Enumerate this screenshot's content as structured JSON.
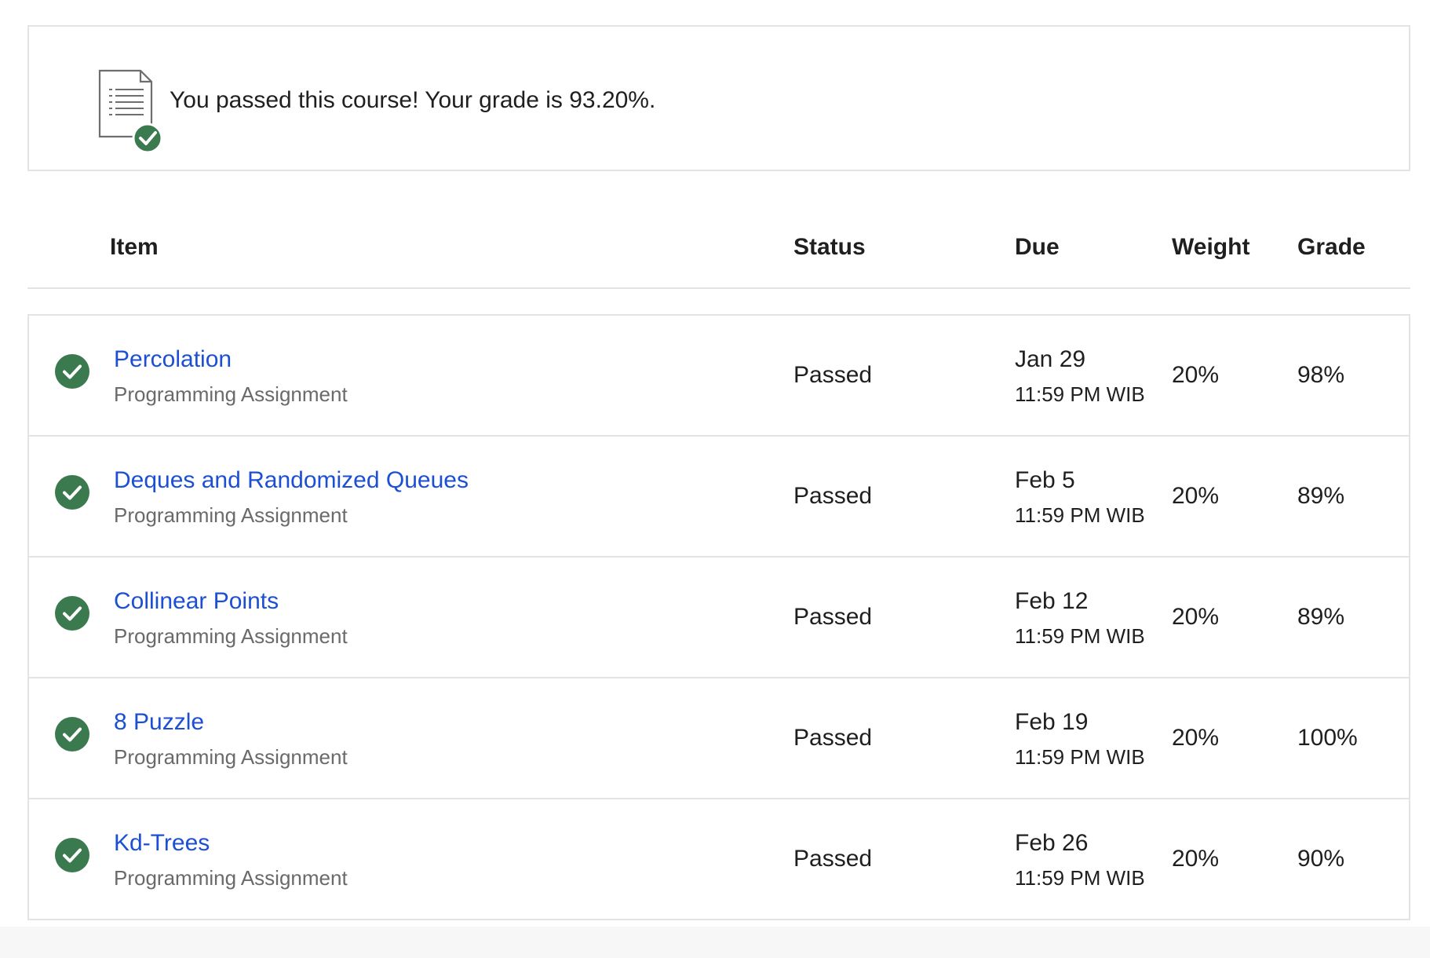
{
  "summary": {
    "icon": "document-check-icon",
    "message": "You passed this course! Your grade is 93.20%."
  },
  "table": {
    "headers": {
      "item": "Item",
      "status": "Status",
      "due": "Due",
      "weight": "Weight",
      "grade": "Grade"
    },
    "rows": [
      {
        "title": "Percolation",
        "type": "Programming Assignment",
        "status": "Passed",
        "due_date": "Jan 29",
        "due_time": "11:59 PM WIB",
        "weight": "20%",
        "grade": "98%"
      },
      {
        "title": "Deques and Randomized Queues",
        "type": "Programming Assignment",
        "status": "Passed",
        "due_date": "Feb 5",
        "due_time": "11:59 PM WIB",
        "weight": "20%",
        "grade": "89%"
      },
      {
        "title": "Collinear Points",
        "type": "Programming Assignment",
        "status": "Passed",
        "due_date": "Feb 12",
        "due_time": "11:59 PM WIB",
        "weight": "20%",
        "grade": "89%"
      },
      {
        "title": "8 Puzzle",
        "type": "Programming Assignment",
        "status": "Passed",
        "due_date": "Feb 19",
        "due_time": "11:59 PM WIB",
        "weight": "20%",
        "grade": "100%"
      },
      {
        "title": "Kd-Trees",
        "type": "Programming Assignment",
        "status": "Passed",
        "due_date": "Feb 26",
        "due_time": "11:59 PM WIB",
        "weight": "20%",
        "grade": "90%"
      }
    ]
  },
  "colors": {
    "link": "#1c4fd4",
    "success": "#3b7a4f",
    "border": "#e3e3e3",
    "muted_text": "#6a6a6a"
  }
}
